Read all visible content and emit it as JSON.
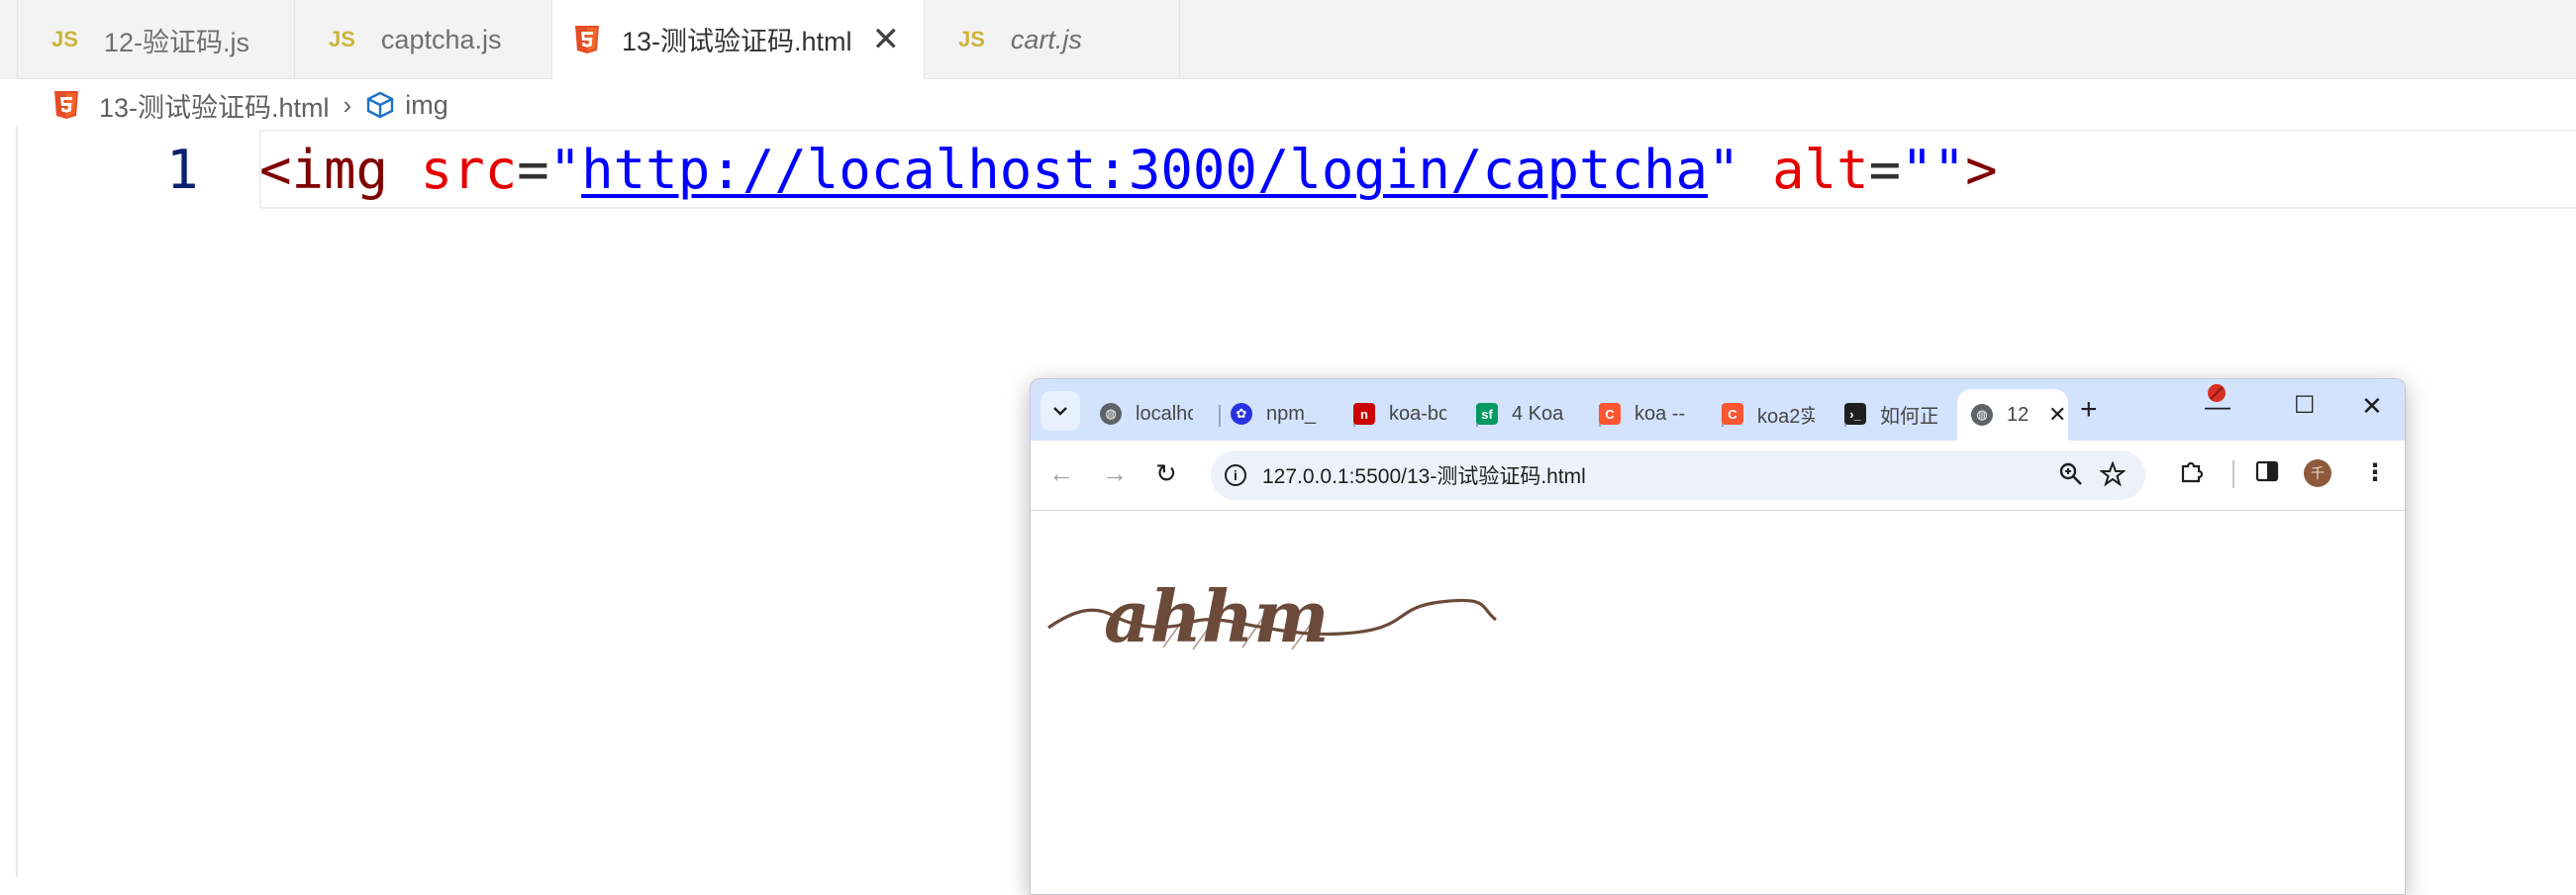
{
  "editor": {
    "tabs": [
      {
        "icon": "JS",
        "label": "12-验证码.js",
        "italic": false
      },
      {
        "icon": "JS",
        "label": "captcha.js",
        "italic": false
      },
      {
        "icon": "html5",
        "label": "13-测试验证码.html",
        "italic": false,
        "close": "✕"
      },
      {
        "icon": "JS",
        "label": "cart.js",
        "italic": true
      }
    ],
    "breadcrumb": {
      "file": "13-测试验证码.html",
      "symbol": "img"
    },
    "code": {
      "line_number": "1",
      "open": "<",
      "tag": "img",
      "attr1": "src",
      "eq": "=",
      "quote": "\"",
      "url": "http://localhost:3000/login/captcha",
      "attr2": "alt",
      "empty": "\"\"",
      "close": ">"
    }
  },
  "browser": {
    "tabs": [
      {
        "title": "localhost",
        "favicon": "globe-icon"
      },
      {
        "title": "npm_",
        "favicon": "baidu-paw-icon"
      },
      {
        "title": "koa-bo",
        "favicon": "npm-icon"
      },
      {
        "title": "4 Koa",
        "favicon": "sf-icon"
      },
      {
        "title": "koa --",
        "favicon": "csdn-icon"
      },
      {
        "title": "koa2实",
        "favicon": "csdn-icon"
      },
      {
        "title": "如何正",
        "favicon": "terminal-icon"
      },
      {
        "title": "12",
        "favicon": "globe-icon",
        "active": true,
        "close": "✕"
      }
    ],
    "new_tab": "+",
    "window_controls": {
      "minimize": "—",
      "maximize": "☐",
      "close": "✕"
    },
    "url": "127.0.0.1:5500/13-测试验证码.html",
    "avatar_text": "千",
    "captcha_text": "ahhm",
    "captcha_color": "#6b4a3a"
  }
}
